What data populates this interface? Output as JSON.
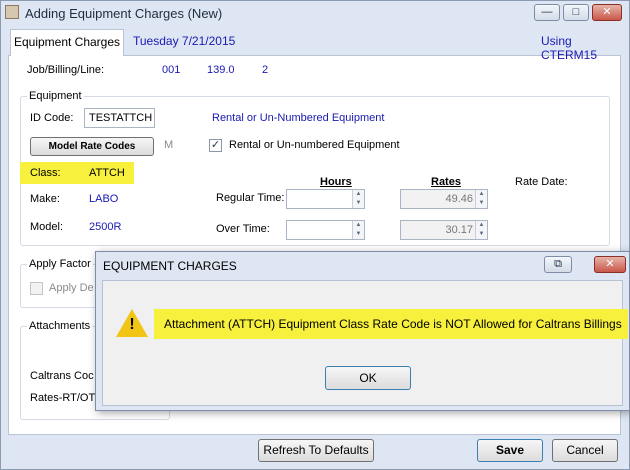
{
  "window": {
    "title": "Adding Equipment Charges  (New)",
    "minimize": "—",
    "maximize": "□",
    "close": "✕"
  },
  "header": {
    "tab_label": "Equipment Charges",
    "date": "Tuesday  7/21/2015",
    "using": "Using CTERM15"
  },
  "job": {
    "label": "Job/Billing/Line:",
    "job": "001",
    "billing": "139.0",
    "line": "2"
  },
  "equipment": {
    "group_title": "Equipment",
    "id_code_label": "ID Code:",
    "id_code_value": "TESTATTCH",
    "rental_text": "Rental or Un-Numbered Equipment",
    "model_rate_button": "Model Rate Codes",
    "m_label": "M",
    "rental_checkbox_label": "Rental or Un-numbered Equipment",
    "rental_checked": true,
    "class_label": "Class:",
    "class_value": "ATTCH",
    "make_label": "Make:",
    "make_value": "LABO",
    "model_label": "Model:",
    "model_value": "2500R",
    "hours_header": "Hours",
    "rates_header": "Rates",
    "rate_date_label": "Rate Date:",
    "regular_label": "Regular Time:",
    "regular_hours": "",
    "regular_rate": "49.46",
    "over_label": "Over Time:",
    "over_hours": "",
    "over_rate": "30.17"
  },
  "apply": {
    "group_title": "Apply Factor",
    "checkbox_label": "Apply De",
    "checked": false
  },
  "attachments": {
    "group_title": "Attachments",
    "caltrans_label": "Caltrans Coc",
    "rates_label": "Rates-RT/OT:"
  },
  "footer": {
    "refresh_button": "Refresh To Defaults",
    "save_button": "Save",
    "cancel_button": "Cancel"
  },
  "dialog": {
    "title": "EQUIPMENT CHARGES",
    "message": "Attachment (ATTCH) Equipment Class Rate Code is NOT Allowed for Caltrans Billings",
    "ok_button": "OK",
    "icon": "warning-icon"
  }
}
